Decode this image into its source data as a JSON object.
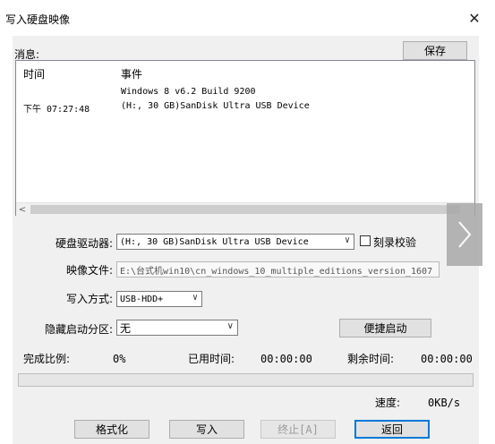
{
  "window": {
    "title": "写入硬盘映像"
  },
  "messages": {
    "label": "消息:",
    "save_label": "保存",
    "columns": {
      "time": "时间",
      "event": "事件"
    },
    "rows": [
      {
        "time": "",
        "event": "Windows 8 v6.2 Build 9200"
      },
      {
        "time": "下午 07:27:48",
        "event": "(H:, 30 GB)SanDisk Ultra USB Device"
      }
    ]
  },
  "drive": {
    "label": "硬盘驱动器:",
    "value": "(H:, 30 GB)SanDisk Ultra USB Device",
    "verify_label": "刻录校验",
    "verify_checked": false
  },
  "image": {
    "label": "映像文件:",
    "value": "E:\\台式机win10\\cn_windows_10_multiple_editions_version_1607"
  },
  "write_mode": {
    "label": "写入方式:",
    "value": "USB-HDD+"
  },
  "hidden_partition": {
    "label": "隐藏启动分区:",
    "value": "无"
  },
  "quick_boot_label": "便捷启动",
  "status": {
    "progress_label": "完成比例:",
    "progress_value": "0%",
    "progress_fraction": 0,
    "elapsed_label": "已用时间:",
    "elapsed_value": "00:00:00",
    "remaining_label": "剩余时间:",
    "remaining_value": "00:00:00",
    "speed_label": "速度:",
    "speed_value": "0KB/s"
  },
  "buttons": {
    "format": "格式化",
    "write": "写入",
    "abort": "终止[A]",
    "back": "返回"
  },
  "colors": {
    "accent": "#0078d7",
    "progress": "#06b025"
  }
}
